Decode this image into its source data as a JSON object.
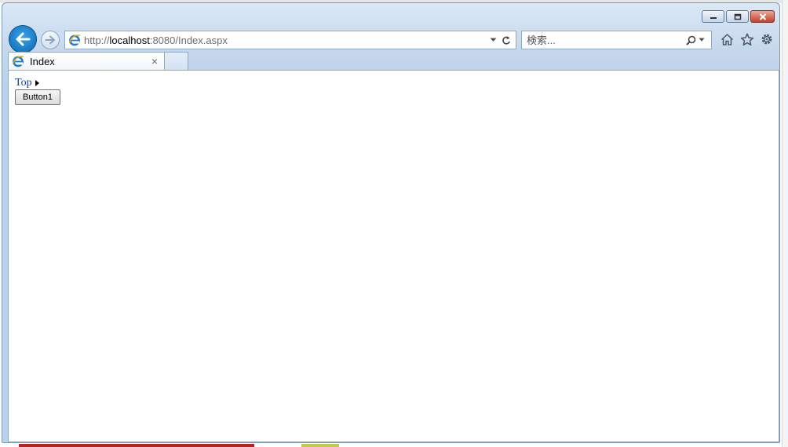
{
  "browser": {
    "address": {
      "scheme": "http://",
      "host": "localhost",
      "rest": ":8080/Index.aspx"
    },
    "search": {
      "placeholder": "検索..."
    },
    "tab": {
      "label": "Index",
      "close_glyph": "×"
    },
    "icons": {
      "back": "back-arrow-icon",
      "forward": "forward-arrow-icon",
      "refresh": "refresh-icon",
      "dropdown": "chevron-down-icon",
      "search": "magnifier-icon",
      "home": "home-icon",
      "favorites": "star-icon",
      "tools": "gear-icon"
    },
    "colors": {
      "back_button": "#0b67b5",
      "close_button": "#c7402a",
      "link": "#0a3fa8"
    }
  },
  "page": {
    "breadcrumb": {
      "top_link": "Top"
    },
    "button1_label": "Button1"
  }
}
